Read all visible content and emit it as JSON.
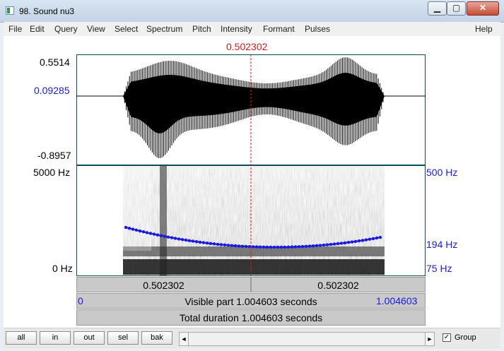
{
  "window": {
    "title": "98. Sound nu3",
    "controls": {
      "minimize": "▁",
      "maximize": "▢",
      "close": "✕"
    }
  },
  "menu": [
    "File",
    "Edit",
    "Query",
    "View",
    "Select",
    "Spectrum",
    "Pitch",
    "Intensity",
    "Formant",
    "Pulses"
  ],
  "help_menu": "Help",
  "cursor": {
    "time_label": "0.502302",
    "position": 0.5
  },
  "waveform": {
    "max_label": "0.5514",
    "cursor_value_label": "0.09285",
    "min_label": "-0.8957"
  },
  "spectrogram": {
    "top_freq_label": "5000 Hz",
    "bottom_freq_label": "0 Hz"
  },
  "pitch": {
    "top_label": "500 Hz",
    "cursor_label": "194 Hz",
    "bottom_label": "75 Hz",
    "color": "#1a1adf"
  },
  "time_bar": {
    "left_part": "0.502302",
    "right_part": "0.502302"
  },
  "visible_bar": {
    "start": "0",
    "text": "Visible part 1.004603 seconds",
    "end": "1.004603"
  },
  "total_bar": {
    "text": "Total duration 1.004603 seconds"
  },
  "zoom_buttons": [
    "all",
    "in",
    "out",
    "sel",
    "bak"
  ],
  "group": {
    "label": "Group",
    "checked": true,
    "check_mark": "✓"
  },
  "scroll": {
    "left_arrow": "◄",
    "right_arrow": "►"
  }
}
